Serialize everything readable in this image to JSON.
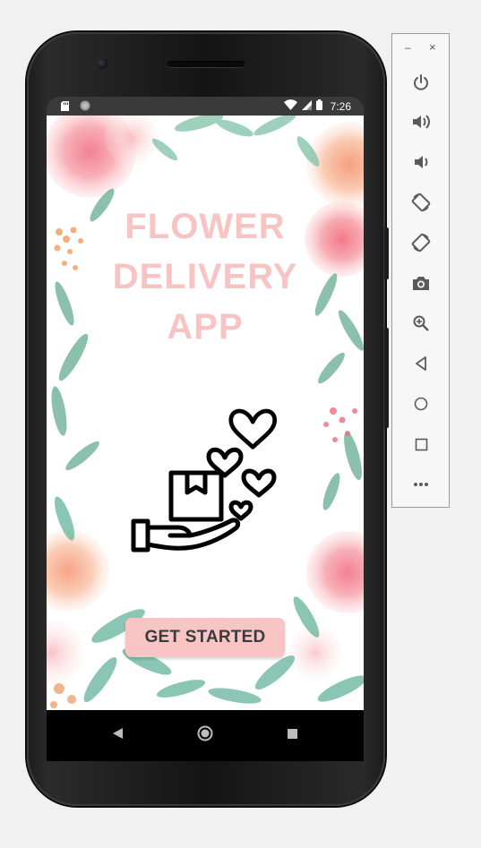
{
  "status_bar": {
    "time": "7:26",
    "icons": [
      "sd-card-icon",
      "sync-icon",
      "wifi-icon",
      "signal-icon",
      "battery-icon"
    ]
  },
  "app": {
    "title_lines": [
      "FLOWER",
      "DELIVERY",
      "APP"
    ],
    "get_started_label": "GET STARTED",
    "hero_icon": "hand-package-hearts-icon",
    "colors": {
      "title": "#f8c3c3",
      "button": "#f9c4c4",
      "button_text": "#3b3b3b"
    }
  },
  "nav_bar": {
    "items": [
      "back-icon",
      "home-icon",
      "recents-icon"
    ]
  },
  "emulator_toolbar": {
    "minimize_label": "–",
    "close_label": "×",
    "buttons": [
      {
        "name": "power-button",
        "icon": "power-icon"
      },
      {
        "name": "volume-up-button",
        "icon": "volume-up-icon"
      },
      {
        "name": "volume-down-button",
        "icon": "volume-down-icon"
      },
      {
        "name": "rotate-left-button",
        "icon": "rotate-left-icon"
      },
      {
        "name": "rotate-right-button",
        "icon": "rotate-right-icon"
      },
      {
        "name": "screenshot-button",
        "icon": "camera-icon"
      },
      {
        "name": "zoom-button",
        "icon": "zoom-icon"
      },
      {
        "name": "back-button",
        "icon": "back-triangle-icon"
      },
      {
        "name": "home-button",
        "icon": "home-circle-icon"
      },
      {
        "name": "overview-button",
        "icon": "overview-square-icon"
      },
      {
        "name": "more-button",
        "icon": "more-icon"
      }
    ]
  }
}
